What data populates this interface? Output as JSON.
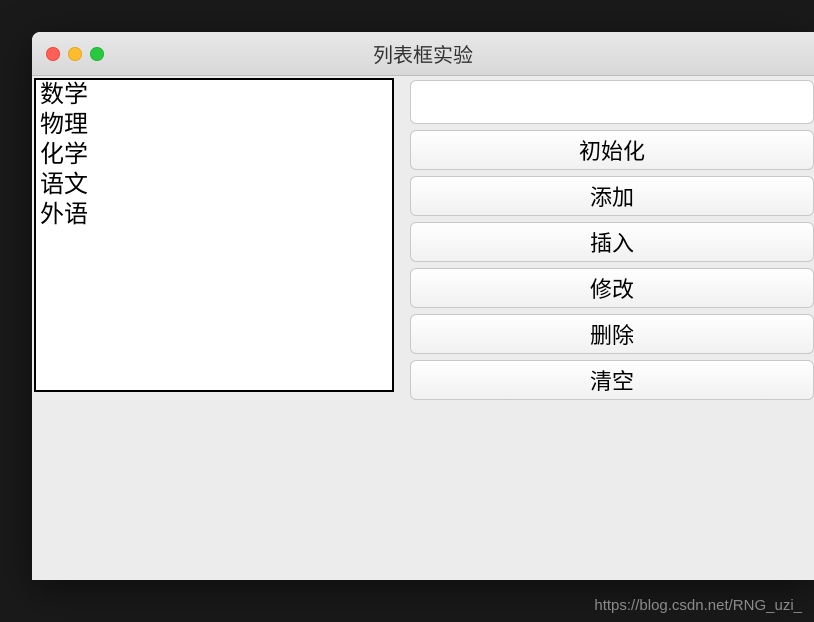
{
  "window": {
    "title": "列表框实验"
  },
  "listbox": {
    "items": [
      "数学",
      "物理",
      "化学",
      "语文",
      "外语"
    ]
  },
  "input": {
    "value": ""
  },
  "buttons": {
    "init": "初始化",
    "add": "添加",
    "insert": "插入",
    "modify": "修改",
    "delete": "删除",
    "clear": "清空"
  },
  "watermark": "https://blog.csdn.net/RNG_uzi_"
}
